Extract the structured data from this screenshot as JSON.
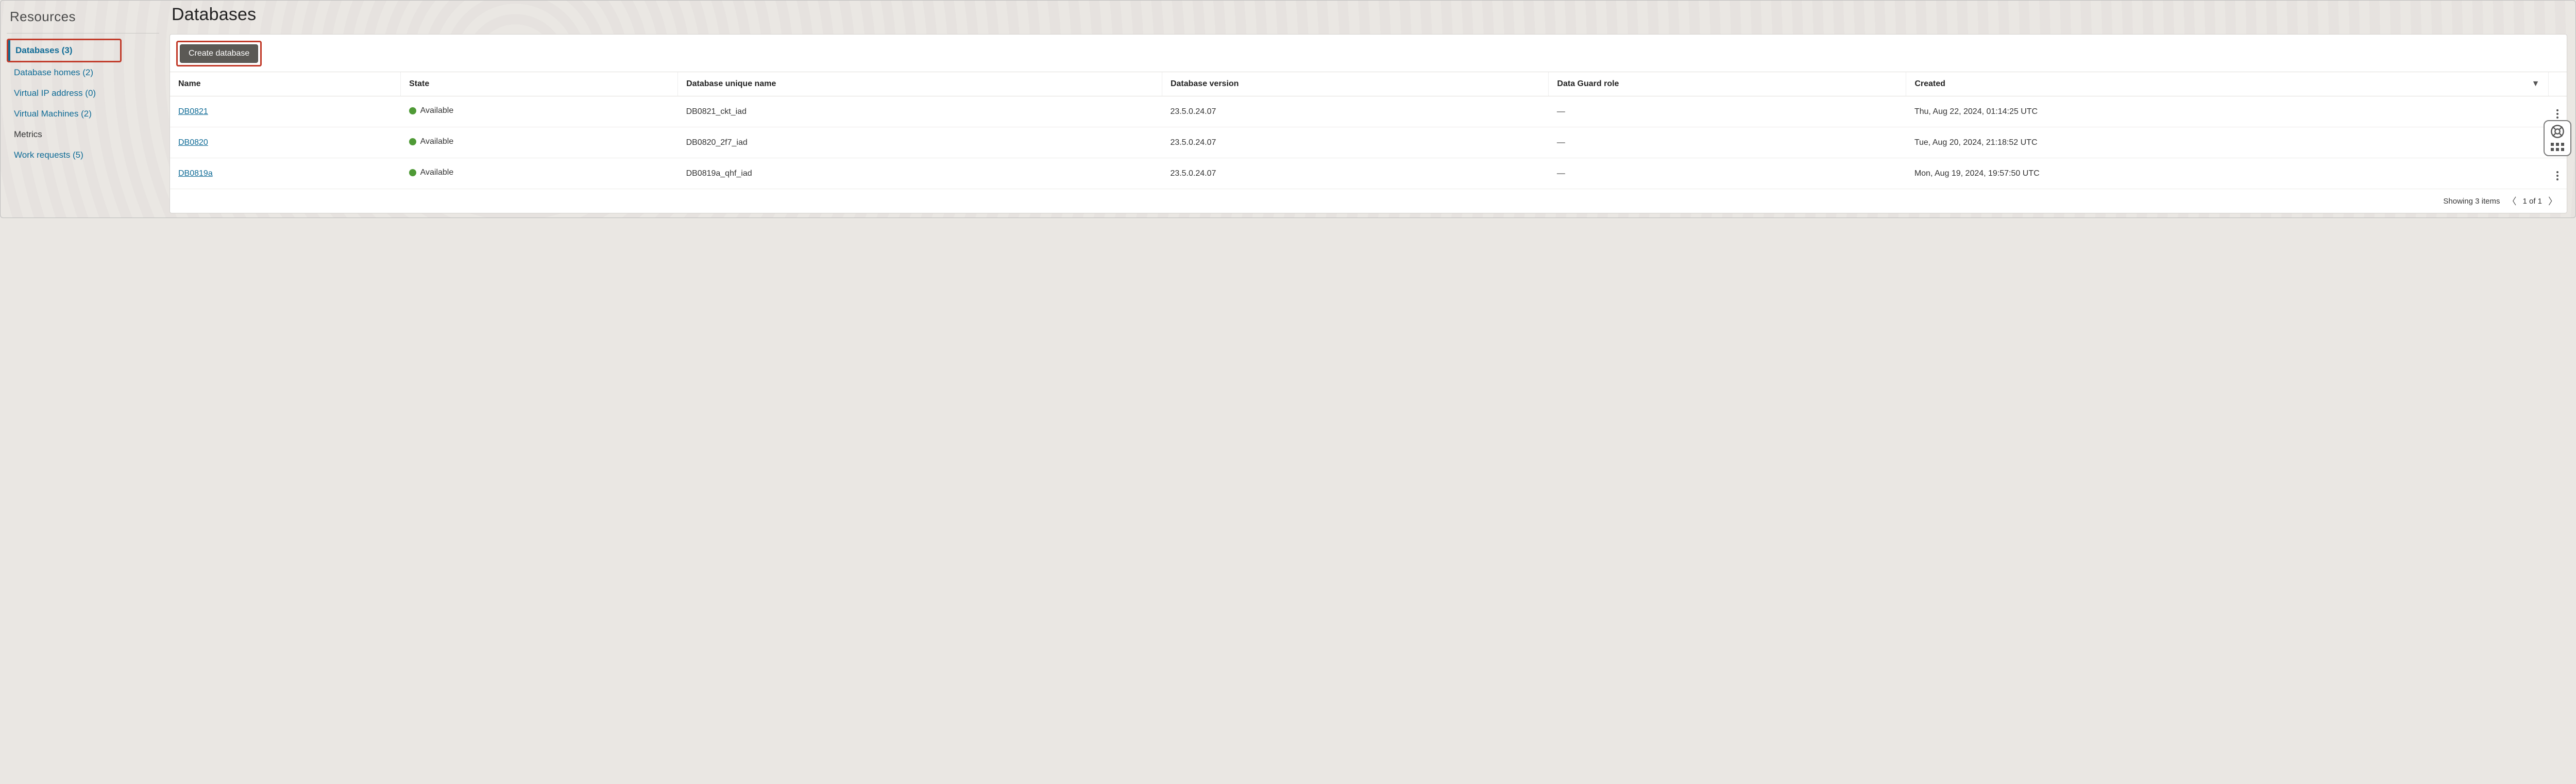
{
  "sidebar": {
    "title": "Resources",
    "items": [
      {
        "label": "Databases (3)",
        "active": true,
        "highlighted": true
      },
      {
        "label": "Database homes (2)"
      },
      {
        "label": "Virtual IP address (0)"
      },
      {
        "label": "Virtual Machines (2)"
      },
      {
        "label": "Metrics",
        "plain": true
      },
      {
        "label": "Work requests (5)"
      }
    ]
  },
  "page": {
    "title": "Databases"
  },
  "toolbar": {
    "create_label": "Create database"
  },
  "table": {
    "columns": {
      "name": "Name",
      "state": "State",
      "unique": "Database unique name",
      "version": "Database version",
      "dg": "Data Guard role",
      "created": "Created"
    },
    "rows": [
      {
        "name": "DB0821",
        "state": "Available",
        "unique": "DB0821_ckt_iad",
        "version": "23.5.0.24.07",
        "dg": "—",
        "created": "Thu, Aug 22, 2024, 01:14:25 UTC"
      },
      {
        "name": "DB0820",
        "state": "Available",
        "unique": "DB0820_2f7_iad",
        "version": "23.5.0.24.07",
        "dg": "—",
        "created": "Tue, Aug 20, 2024, 21:18:52 UTC"
      },
      {
        "name": "DB0819a",
        "state": "Available",
        "unique": "DB0819a_qhf_iad",
        "version": "23.5.0.24.07",
        "dg": "—",
        "created": "Mon, Aug 19, 2024, 19:57:50 UTC"
      }
    ]
  },
  "footer": {
    "showing": "Showing 3 items",
    "page": "1 of 1"
  }
}
